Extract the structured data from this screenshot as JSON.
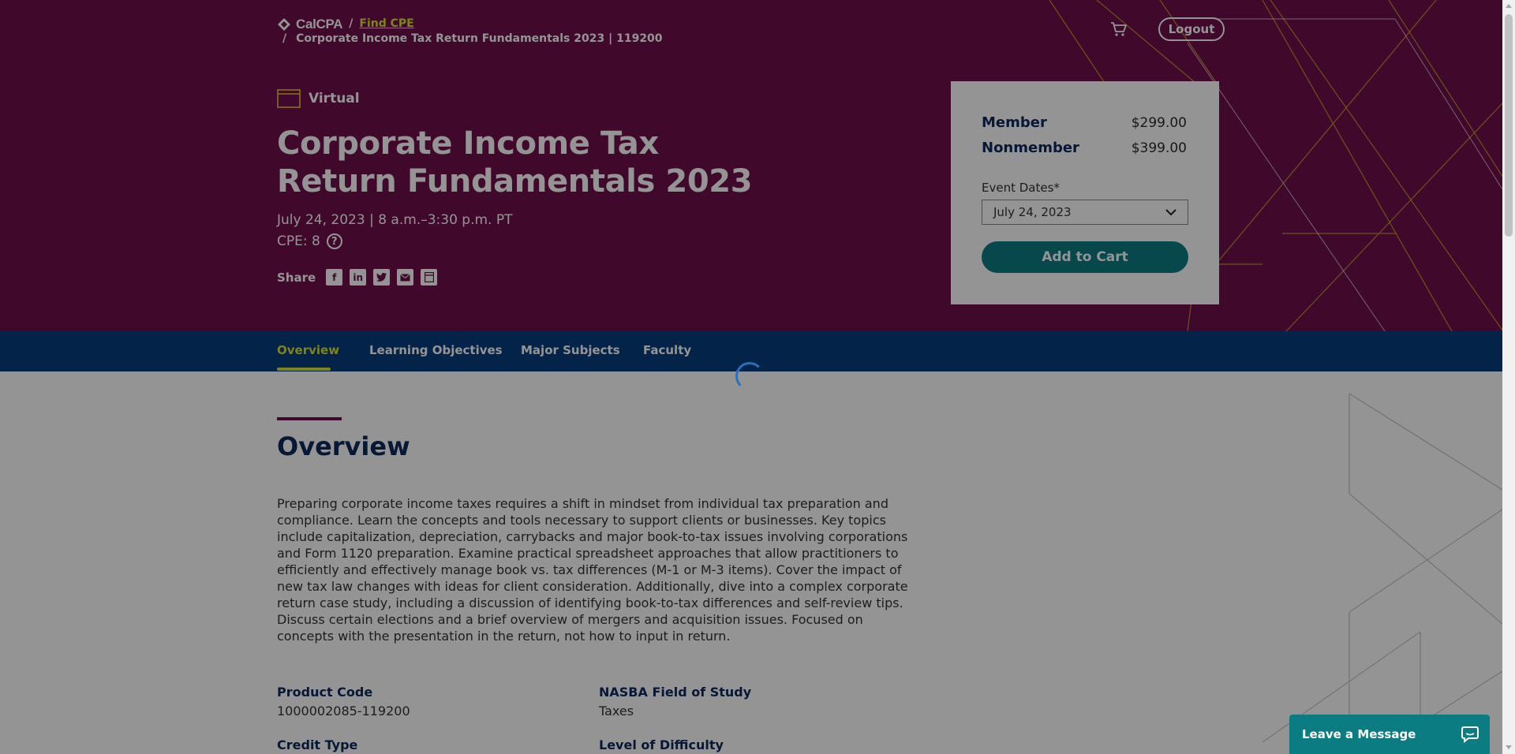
{
  "breadcrumb": {
    "logo": "CalCPA",
    "sep": "/",
    "link": "Find CPE",
    "current": "Corporate Income Tax Return Fundamentals 2023 | 119200"
  },
  "header": {
    "logout": "Logout"
  },
  "course": {
    "format": "Virtual",
    "title": "Corporate Income Tax Return Fundamentals 2023",
    "date": "July 24, 2023 | 8 a.m.–3:30 p.m. PT",
    "cpe": "CPE: 8",
    "help": "?",
    "share_label": "Share"
  },
  "pricing": {
    "member_label": "Member",
    "member_price": "$299.00",
    "nonmember_label": "Nonmember",
    "nonmember_price": "$399.00",
    "event_dates_label": "Event Dates*",
    "event_date_selected": "July 24, 2023",
    "add_to_cart": "Add to Cart"
  },
  "tabs": [
    {
      "label": "Overview",
      "active": true
    },
    {
      "label": "Learning Objectives"
    },
    {
      "label": "Major Subjects"
    },
    {
      "label": "Faculty"
    }
  ],
  "overview": {
    "heading": "Overview",
    "text": "Preparing corporate income taxes requires a shift in mindset from individual tax preparation and compliance. Learn the concepts and tools necessary to support clients or businesses. Key topics include capitalization, depreciation, carrybacks and major book-to-tax issues involving corporations and Form 1120 preparation. Examine practical spreadsheet approaches that allow practitioners to efficiently and effectively manage book vs. tax differences (M-1 or M-3 items). Cover the impact of new tax law changes with ideas for client consideration. Additionally, dive into a complex corporate return case study, including a discussion of identifying book-to-tax differences and self-review tips. Discuss certain elections and a brief overview of mergers and acquisition issues. Focused on concepts with the presentation in the return, not how to input in return."
  },
  "meta": {
    "product_code_label": "Product Code",
    "product_code": "1000002085-119200",
    "field_label": "NASBA Field of Study",
    "field": "Taxes",
    "credit_type_label": "Credit Type",
    "difficulty_label": "Level of Difficulty"
  },
  "chat": {
    "label": "Leave a Message"
  },
  "colors": {
    "hero": "#6e0f4a",
    "nav": "#063d7c",
    "accent": "#d8e23a",
    "button": "#0c7c83",
    "heading": "#0b2a5c"
  }
}
